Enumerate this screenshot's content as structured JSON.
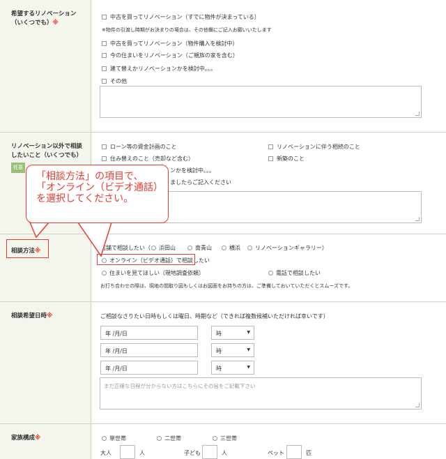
{
  "renovation": {
    "label": "希望するリノベーション",
    "label2": "（いくつでも）",
    "req": "※",
    "opt1": "中古を買ってリノベーション（すでに物件が決まっている）",
    "note": "※物件の引渡し時期がお決まりの場合は、その他欄にご記入お願いいたします",
    "opt2": "中古を買ってリノベーション（物件購入を検討中）",
    "opt3": "今の住まいをリノベーション（ご親族の家を含む）",
    "opt4": "建て替えかリノベーションかを検討中。。。",
    "opt5": "その他"
  },
  "other": {
    "label": "リノベーション以外で相談",
    "label2": "したいこと（いくつでも）",
    "badge": "任意",
    "opt1": "ローン等の資金計画のこと",
    "opt2": "リノベーションに伴う相続のこと",
    "opt3": "住み替えのこと（売却など含む）",
    "opt4": "新築のこと",
    "opt5": "ンかを検討中。。。",
    "opt6": "ましたらご記入ください"
  },
  "method": {
    "label": "相談方法",
    "req": "※",
    "store": "店舗で相談したい（",
    "s1": "浜田山",
    "s2": "南青山",
    "s3": "横浜",
    "s4": "リノベーションギャラリー）",
    "online": "オンライン（ビデオ通話）で相談したい",
    "visit": "住まいを見てほしい（現地調査依頼）",
    "phone": "電話で相談したい",
    "note": "お打ち合わせの際は、現地の間取り図もしくはお図面をお持ちの方は、ご準備しておいていただくとスムーズです。"
  },
  "datetime": {
    "label": "相談希望日時",
    "req": "※",
    "desc": "ご相談なさりたい日時もしくは曜日、時期など（できれば複数候補いただければ幸いです）",
    "date_ph": "年 /月/日",
    "time": "時",
    "textarea_ph": "まだ正確な日程が分からない方はこちらにその旨をご記載下さい"
  },
  "family": {
    "label": "家族構成",
    "req": "※",
    "r1": "単世帯",
    "r2": "二世帯",
    "r3": "三世帯",
    "adult": "大人",
    "child": "子ども",
    "pet": "ペット",
    "unit_person": "人",
    "unit_pet": "匹"
  },
  "callout": {
    "line1": "「相談方法」の項目で、",
    "line2": "「オンライン（ビデオ通話）",
    "line3": "を選択してください。"
  },
  "colors": {
    "accent": "#e63a2e",
    "required": "#e83820",
    "badge": "#9bbf7a"
  }
}
